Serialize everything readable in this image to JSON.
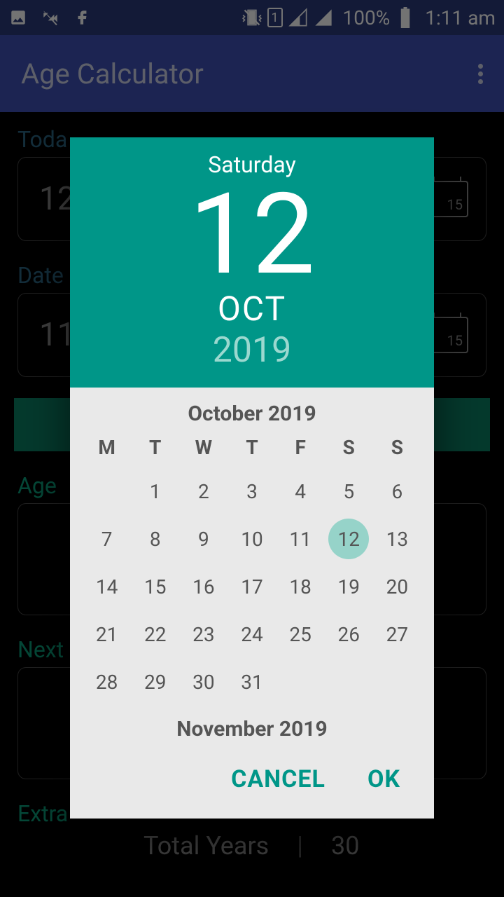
{
  "status": {
    "battery": "100%",
    "time": "1:11 am"
  },
  "app": {
    "title": "Age Calculator"
  },
  "bg": {
    "today_label": "Toda",
    "today_value": "12",
    "dob_label": "Date",
    "dob_value": "11",
    "age_label": "Age",
    "next_label": "Next",
    "extra_label": "Extra",
    "extra_total_label": "Total Years",
    "extra_total_value": "30",
    "cal_icon_num": "15"
  },
  "picker": {
    "weekday": "Saturday",
    "day": "12",
    "month": "OCT",
    "year": "2019",
    "month_title": "October 2019",
    "weekdays": [
      "M",
      "T",
      "W",
      "T",
      "F",
      "S",
      "S"
    ],
    "days": [
      "",
      "1",
      "2",
      "3",
      "4",
      "5",
      "6",
      "7",
      "8",
      "9",
      "10",
      "11",
      "12",
      "13",
      "14",
      "15",
      "16",
      "17",
      "18",
      "19",
      "20",
      "21",
      "22",
      "23",
      "24",
      "25",
      "26",
      "27",
      "28",
      "29",
      "30",
      "31",
      "",
      "",
      ""
    ],
    "selected_day": "12",
    "next_month_title": "November 2019",
    "cancel": "CANCEL",
    "ok": "OK"
  }
}
